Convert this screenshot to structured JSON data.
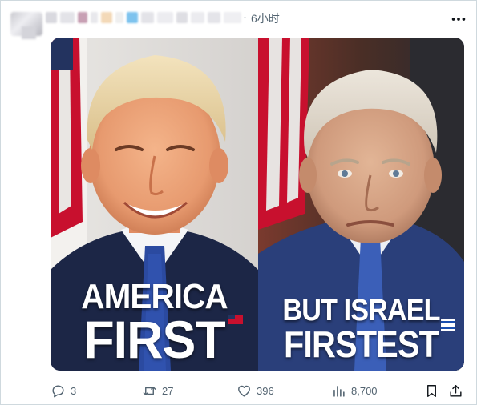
{
  "post": {
    "time": "6小时",
    "separator": "·"
  },
  "media": {
    "left_line1": "AMERICA",
    "left_line2": "FIRST",
    "right_line1": "BUT ISRAEL",
    "right_line2": "FIRSTEST"
  },
  "actions": {
    "replies": "3",
    "reposts": "27",
    "likes": "396",
    "views": "8,700"
  },
  "icons": {
    "reply": "reply-icon",
    "repost": "repost-icon",
    "like": "heart-icon",
    "views": "views-chart-icon",
    "bookmark": "bookmark-icon",
    "share": "share-icon",
    "more": "more-horizontal-icon"
  },
  "colors": {
    "secondary_text": "#536471",
    "border": "#cfd9de"
  }
}
